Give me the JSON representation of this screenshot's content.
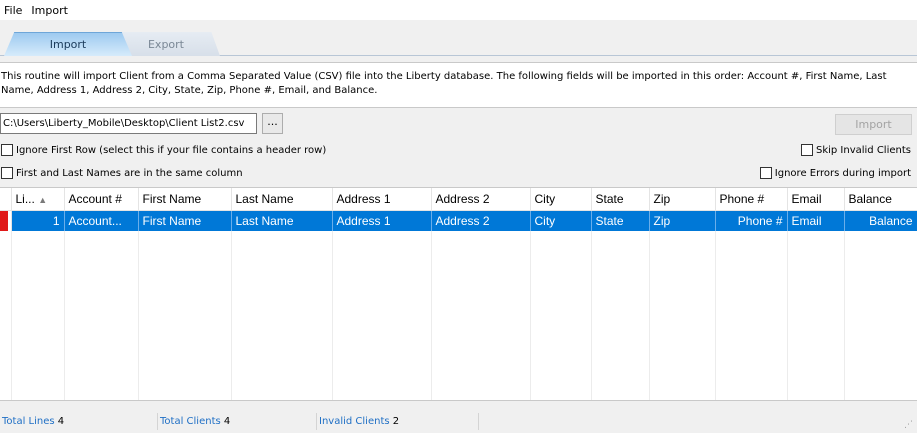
{
  "menu": {
    "file": "File",
    "import": "Import"
  },
  "tabs": {
    "import": "Import",
    "export": "Export"
  },
  "description": "This routine will import Client from a Comma Separated Value (CSV) file into the Liberty database.  The following fields will be imported in this order: Account #, First Name, Last Name, Address 1, Address 2, City, State, Zip, Phone #, Email, and Balance.",
  "file_path": "C:\\Users\\Liberty_Mobile\\Desktop\\Client List2.csv",
  "browse_label": "...",
  "import_button": "Import",
  "options": {
    "ignore_first_row": "Ignore First Row (select this if your file contains a header row)",
    "same_column": "First and Last Names are in the same column",
    "skip_invalid": "Skip Invalid Clients",
    "ignore_errors": "Ignore Errors during import"
  },
  "grid": {
    "columns": [
      "Li...",
      "Account #",
      "First Name",
      "Last Name",
      "Address 1",
      "Address 2",
      "City",
      "State",
      "Zip",
      "Phone #",
      "Email",
      "Balance"
    ],
    "sort_indicator": "▲",
    "rows": [
      [
        "1",
        "Account...",
        "First Name",
        "Last Name",
        "Address 1",
        "Address 2",
        "City",
        "State",
        "Zip",
        "Phone #",
        "Email",
        "Balance"
      ]
    ]
  },
  "status": {
    "total_lines_label": "Total Lines",
    "total_lines_value": "4",
    "total_clients_label": "Total Clients",
    "total_clients_value": "4",
    "invalid_clients_label": "Invalid Clients",
    "invalid_clients_value": "2"
  }
}
